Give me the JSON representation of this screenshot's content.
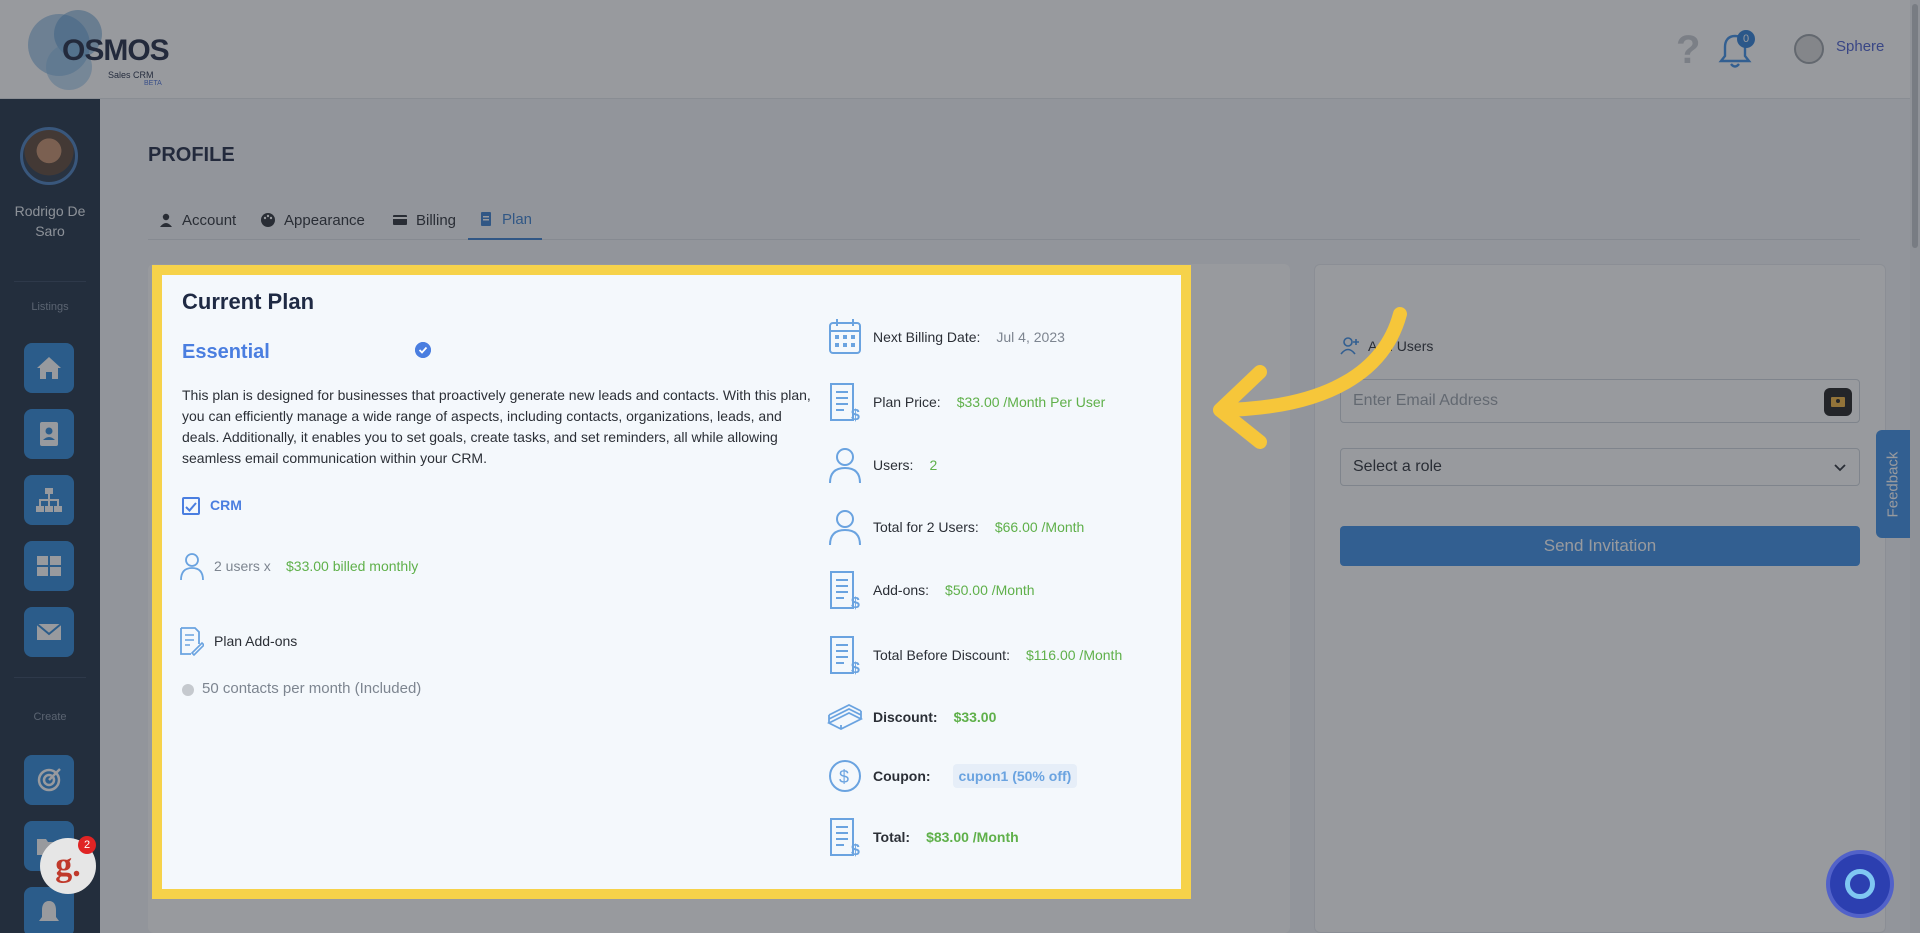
{
  "header": {
    "logo_text": "OSMOS",
    "logo_sub": "Sales CRM",
    "logo_beta": "BETA",
    "help_glyph": "?",
    "notification_count": "0",
    "user_name": "Sphere"
  },
  "sidebar": {
    "user_name": "Rodrigo De Saro",
    "section_listings": "Listings",
    "section_create": "Create",
    "listing_items": [
      "home-icon",
      "contact-card-icon",
      "org-chart-icon",
      "dashboard-icon",
      "mail-icon"
    ],
    "create_items": [
      "target-icon",
      "folder-icon",
      "bell-icon"
    ]
  },
  "page": {
    "title": "PROFILE",
    "tabs": [
      {
        "label": "Account",
        "icon": "user-icon"
      },
      {
        "label": "Appearance",
        "icon": "palette-icon"
      },
      {
        "label": "Billing",
        "icon": "credit-card-icon"
      },
      {
        "label": "Plan",
        "icon": "document-icon",
        "active": true
      }
    ]
  },
  "plan": {
    "title": "Current Plan",
    "plan_name": "Essential",
    "description": "This plan is designed for businesses that proactively generate new leads and contacts. With this plan, you can efficiently manage a wide range of aspects, including contacts, organizations, leads, and deals. Additionally, it enables you to set goals, create tasks, and set reminders, all while allowing seamless email communication within your CRM.",
    "module": "CRM",
    "users_text": "2 users x",
    "users_price": "$33.00 billed monthly",
    "addons_label": "Plan Add-ons",
    "addon_item": "50 contacts per month (Included)",
    "details": {
      "next_billing_label": "Next Billing Date:",
      "next_billing_value": "Jul 4, 2023",
      "price_label": "Plan Price:",
      "price_value": "$33.00 /Month  Per User",
      "users_label": "Users:",
      "users_value": "2",
      "total_users_label": "Total for 2 Users:",
      "total_users_value": "$66.00 /Month",
      "addons_label": "Add-ons:",
      "addons_value": "$50.00 /Month",
      "before_discount_label": "Total Before Discount:",
      "before_discount_value": "$116.00 /Month",
      "discount_label": "Discount:",
      "discount_value": "$33.00",
      "coupon_label": "Coupon:",
      "coupon_value": "cupon1 (50% off)",
      "total_label": "Total:",
      "total_value": "$83.00 /Month"
    }
  },
  "invite": {
    "title": "Add Users",
    "email_placeholder": "Enter Email Address",
    "role_value": "Select a role",
    "send_label": "Send Invitation"
  },
  "feedback_label": "Feedback",
  "widget": {
    "g_letter": "g.",
    "g_badge": "2"
  },
  "colors": {
    "accent": "#3d8ee6",
    "highlight": "#f6d24a",
    "value_green": "#5fb04a",
    "plan_blue": "#4a7ee0"
  }
}
